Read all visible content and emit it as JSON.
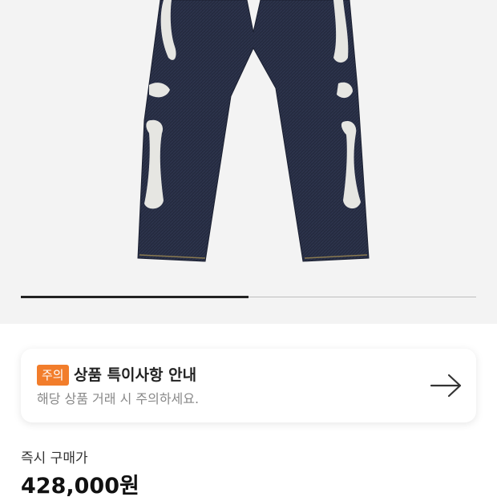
{
  "gallery": {
    "image_description_icon": "jeans-product-photo",
    "progress": 0.5
  },
  "notice": {
    "badge": "주의",
    "title": "상품 특이사항 안내",
    "subtitle": "해당 상품 거래 시 주의하세요.",
    "action_icon": "arrow-right-icon"
  },
  "price": {
    "label": "즉시 구매가",
    "value": "428,000원"
  },
  "colors": {
    "accent": "#f27d2b",
    "denim": "#22283c",
    "bone": "#e8e8e4"
  }
}
